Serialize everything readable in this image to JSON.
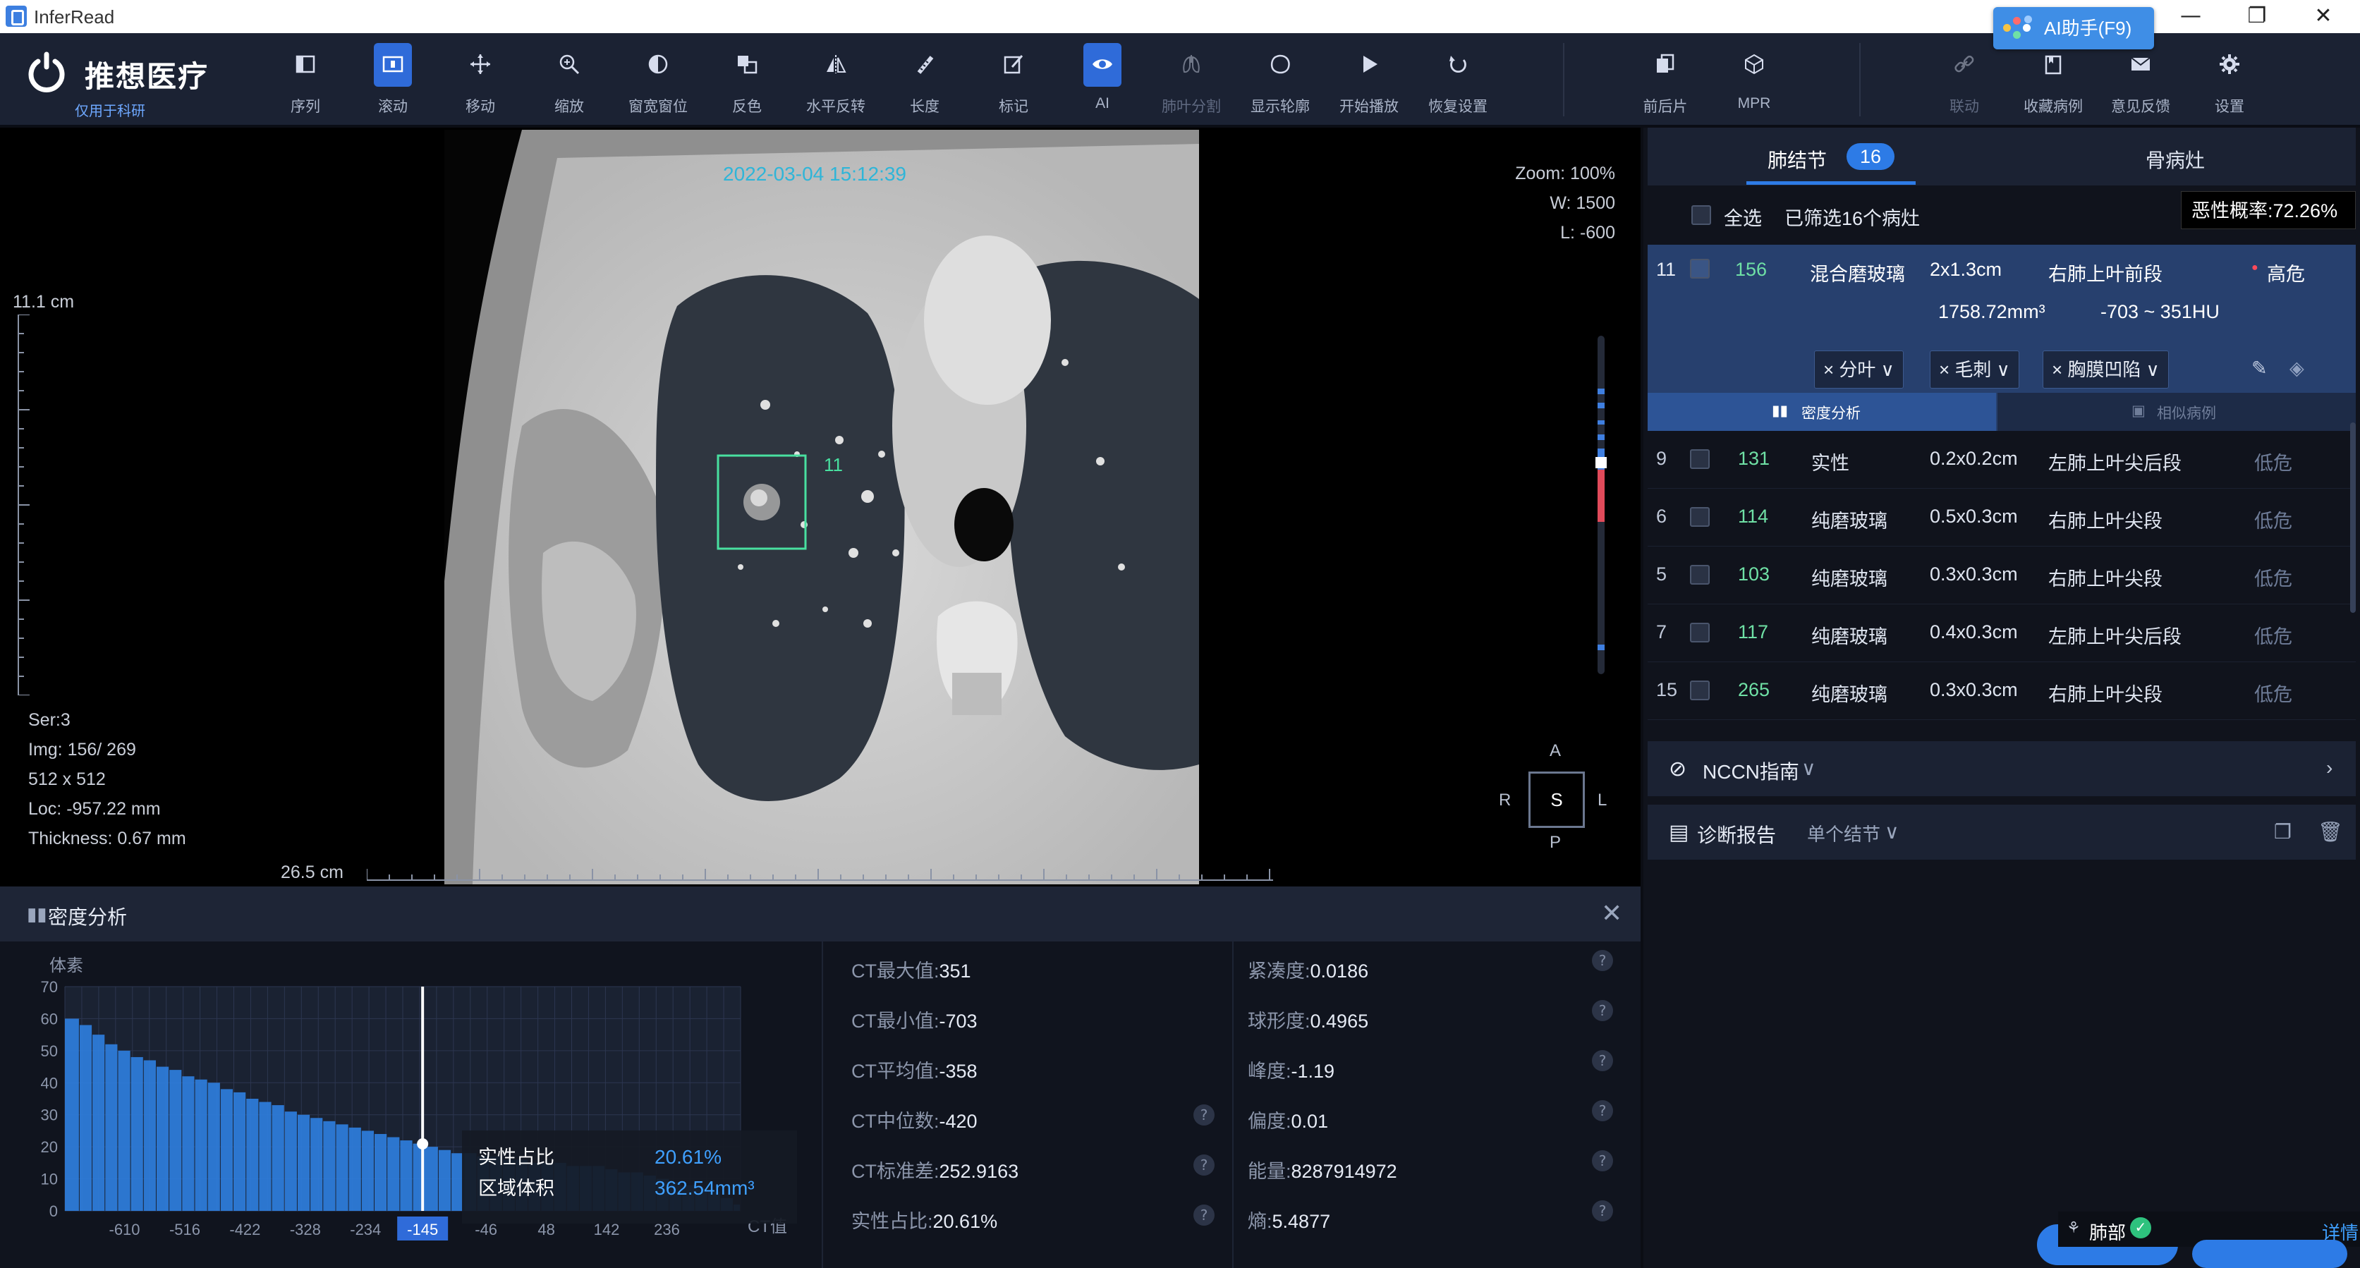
{
  "window": {
    "title": "InferRead",
    "minimize": "—",
    "restore": "❐",
    "close": "✕"
  },
  "ai_assistant": {
    "label": "AI助手(F9)"
  },
  "logo": {
    "name": "推想医疗",
    "subtitle": "仅用于科研"
  },
  "toolbar": {
    "tools": [
      {
        "label": "序列",
        "icon": "series-icon"
      },
      {
        "label": "滚动",
        "icon": "scroll-icon",
        "active": true
      },
      {
        "label": "移动",
        "icon": "move-icon"
      },
      {
        "label": "缩放",
        "icon": "zoom-icon"
      },
      {
        "label": "窗宽窗位",
        "icon": "window-level-icon"
      },
      {
        "label": "反色",
        "icon": "invert-icon"
      },
      {
        "label": "水平反转",
        "icon": "flip-horizontal-icon"
      },
      {
        "label": "长度",
        "icon": "ruler-icon"
      },
      {
        "label": "标记",
        "icon": "annotate-icon"
      },
      {
        "label": "AI",
        "icon": "ai-eye-icon",
        "active": true
      },
      {
        "label": "肺叶分割",
        "icon": "lung-segment-icon",
        "dim": true
      },
      {
        "label": "显示轮廓",
        "icon": "contour-icon"
      },
      {
        "label": "开始播放",
        "icon": "play-icon"
      },
      {
        "label": "恢复设置",
        "icon": "reset-icon"
      },
      {
        "label": "前后片",
        "icon": "compare-icon"
      },
      {
        "label": "MPR",
        "icon": "mpr-icon"
      },
      {
        "label": "联动",
        "icon": "link-icon",
        "dim": true
      },
      {
        "label": "收藏病例",
        "icon": "bookmark-icon"
      },
      {
        "label": "意见反馈",
        "icon": "mail-icon"
      },
      {
        "label": "设置",
        "icon": "gear-icon"
      }
    ]
  },
  "viewer": {
    "timestamp": "2022-03-04 15:12:39",
    "zoom": "Zoom: 100%",
    "window_width": "W: 1500",
    "window_level": "L: -600",
    "scale_vertical": "11.1 cm",
    "scale_horizontal": "26.5 cm",
    "marker_label": "11",
    "info": {
      "series": "Ser:3",
      "image": "Img: 156/ 269",
      "matrix": "512 x 512",
      "location": "Loc: -957.22 mm",
      "thickness": "Thickness: 0.67 mm"
    },
    "orientation": {
      "top": "A",
      "bottom": "P",
      "left": "R",
      "right": "L",
      "center": "S"
    }
  },
  "right_panel": {
    "tab_nodule": "肺结节",
    "tab_nodule_count": "16",
    "tab_bone": "骨病灶",
    "malignancy_tooltip": "恶性概率:72.26%",
    "select_all": "全选",
    "filter_summary": "已筛选16个病灶",
    "selected": {
      "index": "11",
      "image": "156",
      "type": "混合磨玻璃",
      "size": "2x1.3cm",
      "location": "右肺上叶前段",
      "risk": "高危",
      "volume": "1758.72mm³",
      "hu_range": "-703 ~ 351HU",
      "chips": [
        "分叶",
        "毛刺",
        "胸膜凹陷"
      ],
      "subtab_density": "密度分析",
      "subtab_similar": "相似病例"
    },
    "rows": [
      {
        "index": "9",
        "image": "131",
        "type": "实性",
        "size": "0.2x0.2cm",
        "location": "左肺上叶尖后段",
        "risk": "低危"
      },
      {
        "index": "6",
        "image": "114",
        "type": "纯磨玻璃",
        "size": "0.5x0.3cm",
        "location": "右肺上叶尖段",
        "risk": "低危"
      },
      {
        "index": "5",
        "image": "103",
        "type": "纯磨玻璃",
        "size": "0.3x0.3cm",
        "location": "右肺上叶尖段",
        "risk": "低危"
      },
      {
        "index": "7",
        "image": "117",
        "type": "纯磨玻璃",
        "size": "0.4x0.3cm",
        "location": "左肺上叶尖后段",
        "risk": "低危"
      },
      {
        "index": "15",
        "image": "265",
        "type": "纯磨玻璃",
        "size": "0.3x0.3cm",
        "location": "右肺上叶尖段",
        "risk": "低危"
      }
    ],
    "nccn": "NCCN指南",
    "report": "诊断报告",
    "report_mode": "单个结节"
  },
  "status_widget": {
    "lung_label": "肺部",
    "detail": "详情"
  },
  "density": {
    "title": "密度分析",
    "tooltip_solid_label": "实性占比",
    "tooltip_solid_value": "20.61%",
    "tooltip_volume_label": "区域体积",
    "tooltip_volume_value": "362.54mm³",
    "stats_left": [
      {
        "k": "CT最大值:",
        "v": "351"
      },
      {
        "k": "CT最小值:",
        "v": "-703"
      },
      {
        "k": "CT平均值:",
        "v": "-358"
      },
      {
        "k": "CT中位数:",
        "v": "-420"
      },
      {
        "k": "CT标准差:",
        "v": "252.9163"
      },
      {
        "k": "实性占比:",
        "v": "20.61%"
      }
    ],
    "stats_right": [
      {
        "k": "紧凑度:",
        "v": "0.0186"
      },
      {
        "k": "球形度:",
        "v": "0.4965"
      },
      {
        "k": "峰度:",
        "v": "-1.19"
      },
      {
        "k": "偏度:",
        "v": "0.01"
      },
      {
        "k": "能量:",
        "v": "8287914972"
      },
      {
        "k": "熵:",
        "v": "5.4877"
      }
    ]
  },
  "chart_data": {
    "type": "bar",
    "title": "",
    "xlabel": "CT值",
    "ylabel": "体素",
    "ylim": [
      0,
      70
    ],
    "yticks": [
      0,
      10,
      20,
      30,
      40,
      50,
      60,
      70
    ],
    "xticks": [
      "-610",
      "-516",
      "-422",
      "-328",
      "-234",
      "-145",
      "-46",
      "48",
      "142",
      "236"
    ],
    "highlight_tick": "-145",
    "xlim": [
      -703,
      351
    ],
    "threshold": -145,
    "bar_color": "#2f7fe0",
    "series": [
      {
        "x": [
          -703,
          -680,
          -660,
          -640,
          -620,
          -600,
          -580,
          -560,
          -540,
          -520,
          -500,
          -480,
          -460,
          -440,
          -420,
          -400,
          -380,
          -360,
          -340,
          -320,
          -300,
          -280,
          -260,
          -240,
          -220,
          -200,
          -180,
          -160,
          -145,
          -120,
          -100,
          -80,
          -60,
          -40,
          -20,
          0,
          20,
          40,
          60,
          80,
          100,
          120,
          140,
          160,
          180,
          200,
          220,
          240,
          260,
          280,
          300,
          320,
          340,
          351
        ],
        "values": [
          60,
          58,
          55,
          52,
          50,
          48,
          47,
          45,
          44,
          42,
          41,
          40,
          38,
          37,
          35,
          34,
          33,
          31,
          30,
          29,
          28,
          27,
          26,
          25,
          24,
          23,
          22,
          21,
          20,
          19,
          18,
          18,
          17,
          17,
          16,
          16,
          15,
          15,
          15,
          14,
          14,
          14,
          13,
          12,
          12,
          11,
          10,
          9,
          8,
          7,
          6,
          4,
          2,
          1
        ]
      }
    ]
  }
}
